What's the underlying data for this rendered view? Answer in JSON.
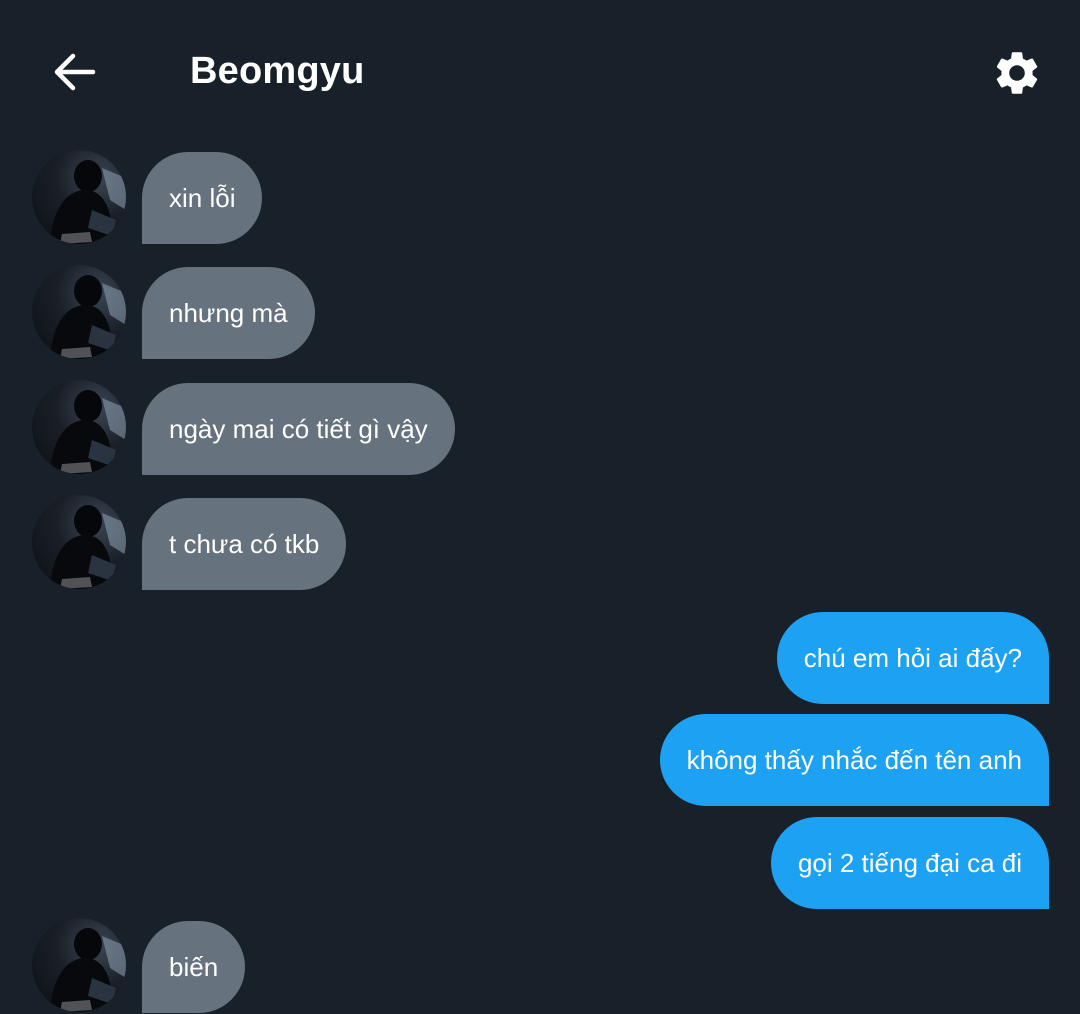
{
  "header": {
    "back_icon": "arrow-left-icon",
    "title": "Beomgyu",
    "settings_icon": "gear-icon"
  },
  "colors": {
    "background": "#182029",
    "incoming_bubble": "#67727f",
    "outgoing_bubble": "#1da1f2",
    "text": "#ffffff"
  },
  "messages": [
    {
      "direction": "incoming",
      "text": "xin lỗi"
    },
    {
      "direction": "incoming",
      "text": "nhưng mà"
    },
    {
      "direction": "incoming",
      "text": "ngày mai có tiết gì vậy"
    },
    {
      "direction": "incoming",
      "text": "t chưa có tkb"
    },
    {
      "direction": "outgoing",
      "text": "chú em hỏi ai đấy?"
    },
    {
      "direction": "outgoing",
      "text": "không thấy nhắc đến tên anh"
    },
    {
      "direction": "outgoing",
      "text": "gọi 2 tiếng đại ca đi"
    },
    {
      "direction": "incoming",
      "text": "biến"
    }
  ]
}
